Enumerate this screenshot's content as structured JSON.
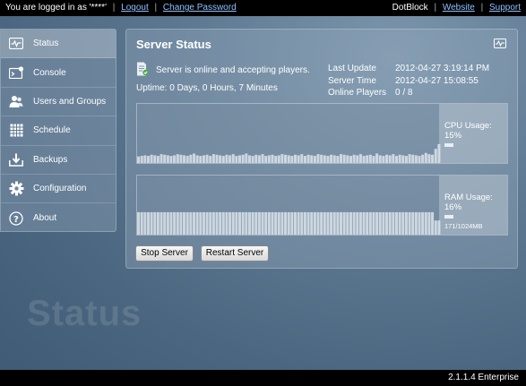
{
  "topbar": {
    "logged_in": "You are logged in as '****'",
    "logout": "Logout",
    "change_password": "Change Password",
    "brand": "DotBlock",
    "website": "Website",
    "support": "Support"
  },
  "sidebar": {
    "items": [
      {
        "label": "Status",
        "icon": "status-icon"
      },
      {
        "label": "Console",
        "icon": "console-icon"
      },
      {
        "label": "Users and Groups",
        "icon": "users-icon"
      },
      {
        "label": "Schedule",
        "icon": "calendar-icon"
      },
      {
        "label": "Backups",
        "icon": "download-icon"
      },
      {
        "label": "Configuration",
        "icon": "gear-icon"
      },
      {
        "label": "About",
        "icon": "help-icon"
      }
    ],
    "active": "Status"
  },
  "panel": {
    "title": "Server Status",
    "status": "Server is online and accepting players.",
    "uptime": "Uptime: 0 Days, 0 Hours, 7 Minutes",
    "info": [
      {
        "key": "Last Update",
        "value": "2012-04-27 3:19:14 PM"
      },
      {
        "key": "Server Time",
        "value": "2012-04-27 15:08:55"
      },
      {
        "key": "Online Players",
        "value": "0 / 8"
      }
    ]
  },
  "cpu": {
    "label": "CPU Usage:",
    "value": "15%",
    "fraction": 0.15,
    "history": [
      11,
      12,
      13,
      12,
      14,
      13,
      12,
      15,
      14,
      13,
      12,
      13,
      15,
      14,
      13,
      12,
      14,
      16,
      13,
      12,
      13,
      14,
      12,
      15,
      14,
      13,
      12,
      14,
      13,
      15,
      12,
      13,
      14,
      16,
      13,
      12,
      14,
      13,
      15,
      12,
      13,
      14,
      12,
      13,
      15,
      14,
      13,
      12,
      14,
      13,
      15,
      12,
      14,
      13,
      12,
      15,
      14,
      13,
      12,
      14,
      13,
      12,
      15,
      14,
      13,
      12,
      14,
      13,
      15,
      12,
      13,
      14,
      12,
      16,
      13,
      12,
      14,
      13,
      15,
      12,
      14,
      13,
      12,
      15,
      14,
      13,
      12,
      14,
      17,
      15,
      14,
      24,
      32
    ]
  },
  "ram": {
    "label": "RAM Usage:",
    "value": "16%",
    "fraction": 0.16,
    "detail": "171/1024MB",
    "history_count": 93
  },
  "buttons": {
    "stop": "Stop Server",
    "restart": "Restart Server"
  },
  "watermark": "Status",
  "footer": "2.1.1.4 Enterprise"
}
